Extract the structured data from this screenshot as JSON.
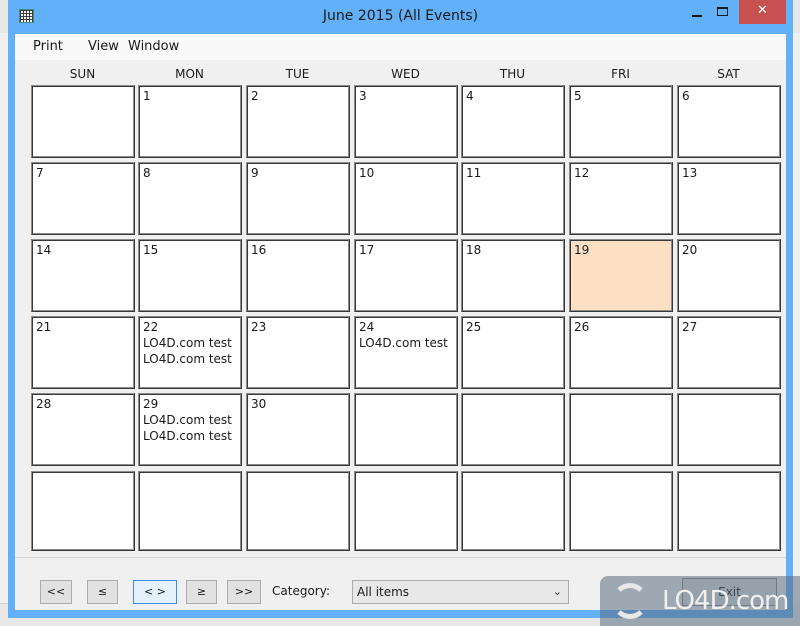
{
  "window": {
    "title": "June 2015 (All Events)",
    "controls": {
      "minimize": "—",
      "maximize": "☐",
      "close": "✕"
    }
  },
  "menu": [
    {
      "label": "Print"
    },
    {
      "label": "View"
    },
    {
      "label": "Window"
    }
  ],
  "calendar": {
    "month": "June 2015",
    "day_headers": [
      "SUN",
      "MON",
      "TUE",
      "WED",
      "THU",
      "FRI",
      "SAT"
    ],
    "today": "19",
    "weeks": [
      [
        {
          "day": "",
          "events": []
        },
        {
          "day": "1",
          "events": []
        },
        {
          "day": "2",
          "events": []
        },
        {
          "day": "3",
          "events": []
        },
        {
          "day": "4",
          "events": []
        },
        {
          "day": "5",
          "events": []
        },
        {
          "day": "6",
          "events": []
        }
      ],
      [
        {
          "day": "7",
          "events": []
        },
        {
          "day": "8",
          "events": []
        },
        {
          "day": "9",
          "events": []
        },
        {
          "day": "10",
          "events": []
        },
        {
          "day": "11",
          "events": []
        },
        {
          "day": "12",
          "events": []
        },
        {
          "day": "13",
          "events": []
        }
      ],
      [
        {
          "day": "14",
          "events": []
        },
        {
          "day": "15",
          "events": []
        },
        {
          "day": "16",
          "events": []
        },
        {
          "day": "17",
          "events": []
        },
        {
          "day": "18",
          "events": []
        },
        {
          "day": "19",
          "events": [],
          "today": true
        },
        {
          "day": "20",
          "events": []
        }
      ],
      [
        {
          "day": "21",
          "events": []
        },
        {
          "day": "22",
          "events": [
            "LO4D.com test",
            "LO4D.com test"
          ]
        },
        {
          "day": "23",
          "events": []
        },
        {
          "day": "24",
          "events": [
            "LO4D.com test"
          ]
        },
        {
          "day": "25",
          "events": []
        },
        {
          "day": "26",
          "events": []
        },
        {
          "day": "27",
          "events": []
        }
      ],
      [
        {
          "day": "28",
          "events": []
        },
        {
          "day": "29",
          "events": [
            "LO4D.com test",
            "LO4D.com test"
          ]
        },
        {
          "day": "30",
          "events": []
        },
        {
          "day": "",
          "events": []
        },
        {
          "day": "",
          "events": []
        },
        {
          "day": "",
          "events": []
        },
        {
          "day": "",
          "events": []
        }
      ],
      [
        {
          "day": "",
          "events": []
        },
        {
          "day": "",
          "events": []
        },
        {
          "day": "",
          "events": []
        },
        {
          "day": "",
          "events": []
        },
        {
          "day": "",
          "events": []
        },
        {
          "day": "",
          "events": []
        },
        {
          "day": "",
          "events": []
        }
      ]
    ]
  },
  "footer": {
    "nav_buttons": [
      {
        "name": "first-button",
        "label": "<<"
      },
      {
        "name": "previous-button",
        "label": "≤"
      },
      {
        "name": "current-button",
        "label": "< >",
        "focused": true
      },
      {
        "name": "next-button",
        "label": "≥"
      },
      {
        "name": "last-button",
        "label": ">>"
      }
    ],
    "category_label": "Category:",
    "category_value": "All items",
    "exit_label": "Exit"
  },
  "watermark": {
    "text": "LO4D.com"
  },
  "colors": {
    "titlebar": "#62b0f7",
    "close": "#c75050",
    "today": "#fde0c4"
  }
}
